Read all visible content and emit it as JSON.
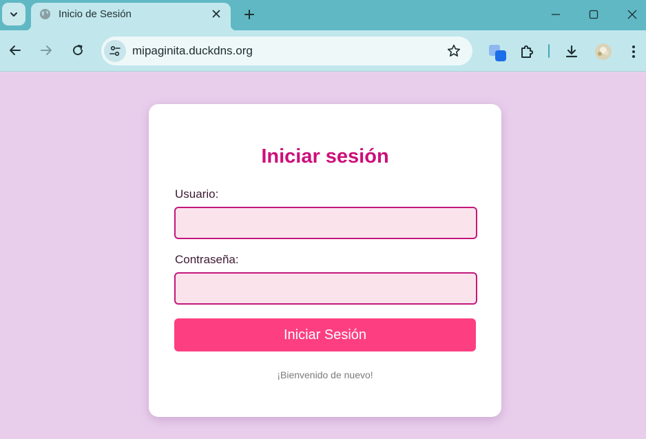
{
  "browser": {
    "tab": {
      "title": "Inicio de Sesión",
      "favicon": "globe-icon"
    },
    "address_bar": {
      "url": "mipaginita.duckdns.org"
    },
    "icons": {
      "tab_search": "chevron-down-icon",
      "new_tab": "plus-icon",
      "minimize": "minimize-icon",
      "maximize": "maximize-icon",
      "close": "close-icon",
      "back": "back-arrow-icon",
      "forward": "forward-arrow-icon",
      "reload": "reload-icon",
      "site_info": "tune-icon",
      "bookmark": "star-icon",
      "extension_app": "app-extension-icon",
      "extensions": "puzzle-icon",
      "downloads": "download-icon",
      "profile": "avatar-icon",
      "menu": "kebab-menu-icon"
    },
    "colors": {
      "tabbar_bg": "#5fb8c3",
      "toolbar_bg": "#c1e7ec"
    }
  },
  "login": {
    "title": "Iniciar sesión",
    "username_label": "Usuario:",
    "username_value": "",
    "password_label": "Contraseña:",
    "password_value": "",
    "submit_label": "Iniciar Sesión",
    "welcome_text": "¡Bienvenido de nuevo!",
    "colors": {
      "page_bg": "#e9ceec",
      "title": "#cc0f7a",
      "field_border": "#c2187c",
      "field_bg": "#fbe3ec",
      "button_bg": "#fd3f81"
    }
  }
}
